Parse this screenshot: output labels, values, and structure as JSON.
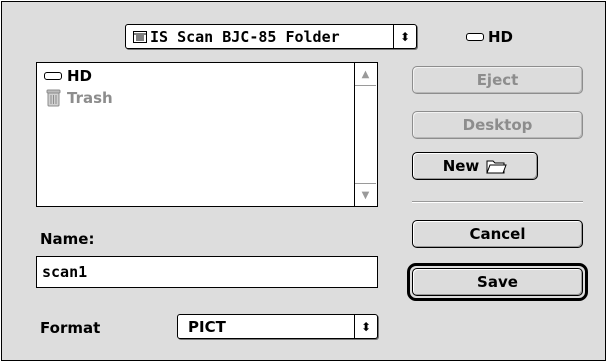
{
  "folder_popup": {
    "label": "IS Scan BJC-85 Folder",
    "arrows": "⬍"
  },
  "volume": {
    "label": "HD",
    "icon": "hard-disk"
  },
  "file_list": {
    "items": [
      {
        "label": "HD",
        "icon": "hard-disk",
        "dimmed": false
      },
      {
        "label": "Trash",
        "icon": "trash",
        "dimmed": true
      }
    ]
  },
  "buttons": {
    "eject": "Eject",
    "desktop": "Desktop",
    "new": "New",
    "cancel": "Cancel",
    "save": "Save"
  },
  "name_field": {
    "label": "Name:",
    "value": "scan1"
  },
  "format": {
    "label": "Format",
    "value": "PICT",
    "arrows": "⬍"
  }
}
